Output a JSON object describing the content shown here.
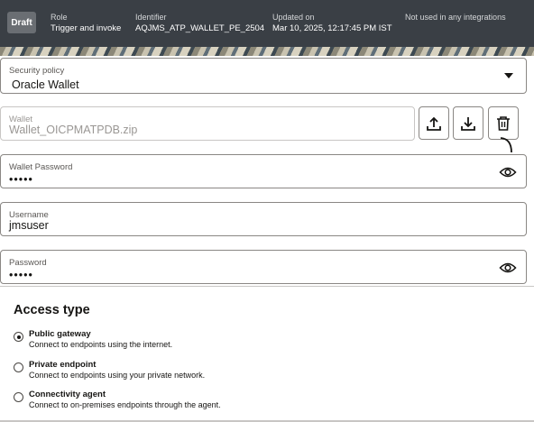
{
  "header": {
    "status_badge": "Draft",
    "role_label": "Role",
    "role_value": "Trigger and invoke",
    "identifier_label": "Identifier",
    "identifier_value": "AQJMS_ATP_WALLET_PE_2504",
    "updated_label": "Updated on",
    "updated_value": "Mar 10, 2025, 12:17:45 PM IST",
    "usage_text": "Not used in any integrations"
  },
  "form": {
    "security_policy": {
      "label": "Security policy",
      "value": "Oracle Wallet"
    },
    "wallet": {
      "label": "Wallet",
      "value": "Wallet_OICPMATPDB.zip"
    },
    "wallet_password": {
      "label": "Wallet Password",
      "value": "•••••"
    },
    "username": {
      "label": "Username",
      "value": "jmsuser"
    },
    "password": {
      "label": "Password",
      "value": "•••••"
    }
  },
  "icons": {
    "upload": "upload-icon",
    "download": "download-icon",
    "delete": "trash-icon",
    "show_password": "eye-icon",
    "dropdown": "caret-down-icon"
  },
  "access_type": {
    "title": "Access type",
    "options": [
      {
        "title": "Public gateway",
        "desc": "Connect to endpoints using the internet.",
        "selected": true
      },
      {
        "title": "Private endpoint",
        "desc": "Connect to endpoints using your private network.",
        "selected": false
      },
      {
        "title": "Connectivity agent",
        "desc": "Connect to on-premises endpoints through the agent.",
        "selected": false
      }
    ]
  }
}
